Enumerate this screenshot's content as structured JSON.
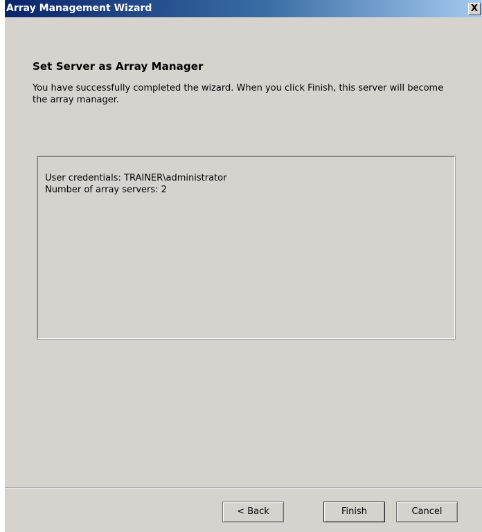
{
  "window": {
    "title": "Array Management Wizard",
    "close_glyph": "X"
  },
  "header": {
    "title": "Set Server as Array Manager",
    "description": "You have successfully completed the wizard. When you click Finish, this server will become the array manager."
  },
  "summary": {
    "lines": [
      "User credentials: TRAINER\\administrator",
      "Number of array servers: 2"
    ]
  },
  "buttons": {
    "back": "< Back",
    "finish": "Finish",
    "cancel": "Cancel"
  },
  "colors": {
    "titlebar_start": "#0a246a",
    "titlebar_end": "#a6caf0",
    "window_bg": "#d6d3ce"
  }
}
